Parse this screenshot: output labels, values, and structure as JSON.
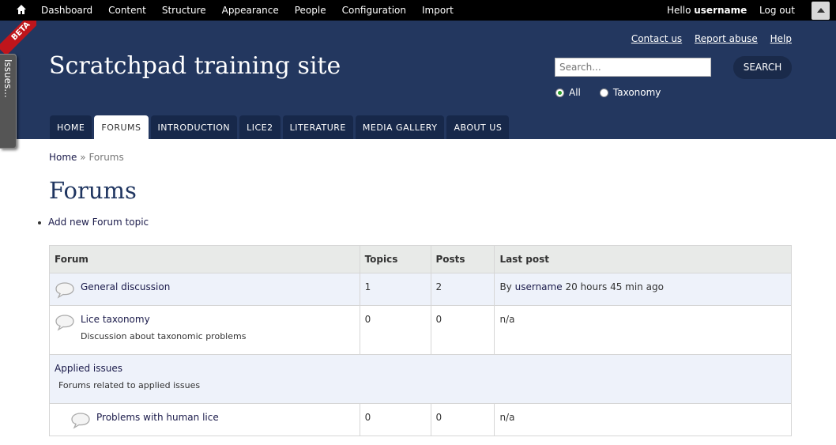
{
  "toolbar": {
    "menu": [
      "Dashboard",
      "Content",
      "Structure",
      "Appearance",
      "People",
      "Configuration",
      "Import"
    ],
    "hello": "Hello",
    "username": "username",
    "logout": "Log out"
  },
  "header": {
    "beta": "BETA",
    "issues_tab": "Issues...",
    "site_title": "Scratchpad training site",
    "links": [
      "Contact us",
      "Report abuse",
      "Help"
    ],
    "search_placeholder": "Search...",
    "search_button": "SEARCH",
    "radio_all": "All",
    "radio_taxonomy": "Taxonomy"
  },
  "tabs": [
    "HOME",
    "FORUMS",
    "INTRODUCTION",
    "LICE2",
    "LITERATURE",
    "MEDIA GALLERY",
    "ABOUT US"
  ],
  "breadcrumb": {
    "home": "Home",
    "separator": "»",
    "current": "Forums"
  },
  "page_title": "Forums",
  "action_link": "Add new Forum topic",
  "table": {
    "headers": [
      "Forum",
      "Topics",
      "Posts",
      "Last post"
    ],
    "rows": [
      {
        "name": "General discussion",
        "description": "",
        "topics": "1",
        "posts": "2",
        "last_by": "By",
        "last_user": "username",
        "last_time": "20 hours 45 min ago"
      },
      {
        "name": "Lice taxonomy",
        "description": "Discussion about taxonomic problems",
        "topics": "0",
        "posts": "0",
        "last_post": "n/a"
      }
    ],
    "container": {
      "name": "Applied issues",
      "description": "Forums related to applied issues"
    },
    "subrow": {
      "name": "Problems with human lice",
      "topics": "0",
      "posts": "0",
      "last_post": "n/a"
    }
  },
  "colors": {
    "header_bg": "#23375f",
    "tab_bg": "#17284a",
    "title": "#1f3560",
    "ribbon": "#c0151b"
  }
}
